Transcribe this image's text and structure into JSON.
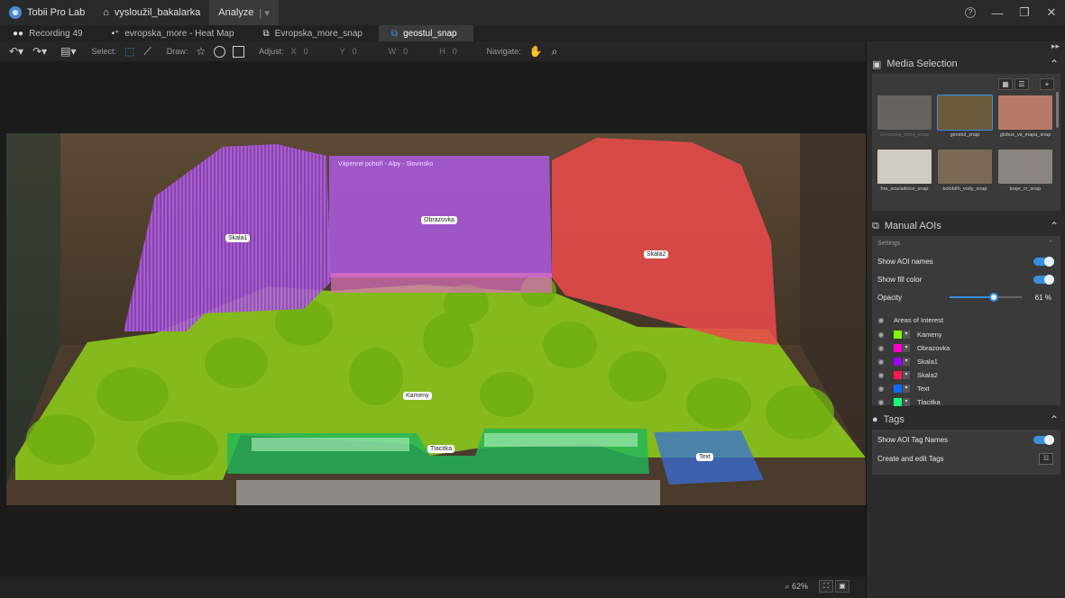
{
  "titlebar": {
    "app_name": "Tobii Pro Lab",
    "project": "vysloužil_bakalarka",
    "mode": "Analyze",
    "help_icon": "?",
    "minimize": "—",
    "maximize": "❐",
    "close": "✕"
  },
  "tabs": [
    {
      "label": "Recording 49",
      "icon": "recording-icon"
    },
    {
      "label": "evropska_more - Heat Map",
      "icon": "heatmap-icon"
    },
    {
      "label": "Evropska_more_snap",
      "icon": "snapshot-icon"
    },
    {
      "label": "geostul_snap",
      "icon": "snapshot-icon",
      "active": true
    }
  ],
  "toolbar": {
    "select_label": "Select:",
    "draw_label": "Draw:",
    "adjust_label": "Adjust:",
    "x_label": "X",
    "x_value": "0",
    "y_label": "Y",
    "y_value": "0",
    "w_label": "W",
    "w_value": "0",
    "h_label": "H",
    "h_value": "0",
    "navigate_label": "Navigate:"
  },
  "scene": {
    "aoi_labels": {
      "skala1": "Skala1",
      "obrazovka": "Obrazovka",
      "skala2": "Skala2",
      "kameny": "Kameny",
      "tlacitka": "Tlacitka",
      "text": "Text"
    },
    "screen_text": "Vápenné pohoří - Alpy - Slovinsko"
  },
  "statusbar": {
    "zoom": "62%"
  },
  "media_selection": {
    "title": "Media Selection",
    "thumbs": [
      {
        "caption": "Evropska_more_snap",
        "color": "#b9b3a5",
        "dim": true
      },
      {
        "caption": "geostul_snap",
        "color": "#6a5a3a",
        "selected": true
      },
      {
        "caption": "globus_vs_mapa_snap",
        "color": "#b77a68"
      },
      {
        "caption": "hra_souradnice_snap",
        "color": "#cfcac2"
      },
      {
        "caption": "koloběh_vody_snap",
        "color": "#7a6a55"
      },
      {
        "caption": "kraje_cr_snap",
        "color": "#8a8580"
      }
    ]
  },
  "manual_aois": {
    "title": "Manual AOIs",
    "settings_label": "Settings",
    "show_names_label": "Show AOI names",
    "show_fill_label": "Show fill color",
    "opacity_label": "Opacity",
    "opacity_value": "61",
    "opacity_unit": "%",
    "opacity_fraction": 0.61,
    "aoi_header": "Areas of Interest",
    "aois": [
      {
        "name": "Kameny",
        "color": "#7fff00"
      },
      {
        "name": "Obrazovka",
        "color": "#ff00cc"
      },
      {
        "name": "Skala1",
        "color": "#9a00ff"
      },
      {
        "name": "Skala2",
        "color": "#ff1a4a"
      },
      {
        "name": "Text",
        "color": "#0f6bff"
      },
      {
        "name": "Tlacitka",
        "color": "#19ff7a"
      }
    ]
  },
  "tags": {
    "title": "Tags",
    "show_tag_names_label": "Show AOI Tag Names",
    "create_edit_label": "Create and edit Tags"
  }
}
